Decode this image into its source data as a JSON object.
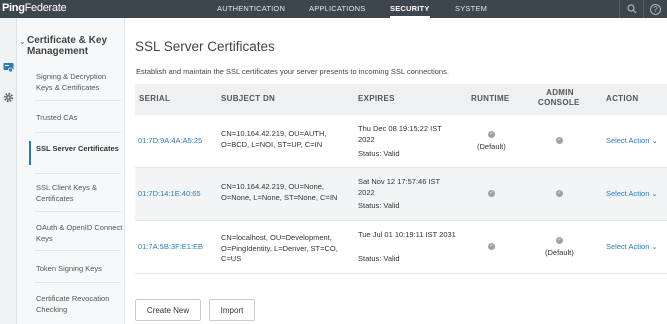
{
  "brand": {
    "bold": "Ping",
    "regular": "Federate"
  },
  "nav": [
    "AUTHENTICATION",
    "APPLICATIONS",
    "SECURITY",
    "SYSTEM"
  ],
  "nav_active": "SECURITY",
  "sidebar": {
    "header": "Certificate & Key Management",
    "items": [
      "Signing & Decryption Keys & Certificates",
      "Trusted CAs",
      "SSL Server Certificates",
      "SSL Client Keys & Certificates",
      "OAuth & OpenID Connect Keys",
      "Token Signing Keys",
      "Certificate Revocation Checking"
    ],
    "active_index": 2
  },
  "page": {
    "title": "SSL Server Certificates",
    "description": "Establish and maintain the SSL certificates your server presents to incoming SSL connections."
  },
  "table": {
    "headers": {
      "serial": "SERIAL",
      "subject": "SUBJECT DN",
      "expires": "EXPIRES",
      "runtime": "RUNTIME",
      "admin_l1": "ADMIN",
      "admin_l2": "CONSOLE",
      "action": "ACTION"
    },
    "rows": [
      {
        "serial": "01:7D:9A:4A:A5:25",
        "subject": "CN=10.164.42.219, OU=AUTH, O=BCD, L=NOI, ST=UP, C=IN",
        "expires": "Thu Dec 08 19:15:22 IST 2022",
        "status": "Status:  Valid",
        "runtime_default": "(Default)",
        "admin_default": "",
        "action": "Select Action"
      },
      {
        "serial": "01:7D:14:1E:40:65",
        "subject": "CN=10.164.42.219, OU=None, O=None, L=None, ST=None, C=IN",
        "expires": "Sat Nov 12 17:57:46 IST 2022",
        "status": "Status:  Valid",
        "runtime_default": "",
        "admin_default": "",
        "action": "Select Action"
      },
      {
        "serial": "01:7A:5B:3F:E1:EB",
        "subject": "CN=localhost, OU=Development, O=PingIdentity, L=Denver, ST=CO, C=US",
        "expires": "Tue Jul 01 10:19:11 IST 2031",
        "status": "Status:  Valid",
        "runtime_default": "",
        "admin_default": "(Default)",
        "action": "Select Action"
      }
    ]
  },
  "buttons": {
    "create": "Create New",
    "import": "Import"
  },
  "icons": [
    "search-icon",
    "help-icon",
    "certificate-icon",
    "gear-icon",
    "check-icon",
    "chevron-down-icon"
  ],
  "colors": {
    "topbar": "#3d454d",
    "link": "#2b7bb9",
    "header_bg": "#eef0f2"
  }
}
